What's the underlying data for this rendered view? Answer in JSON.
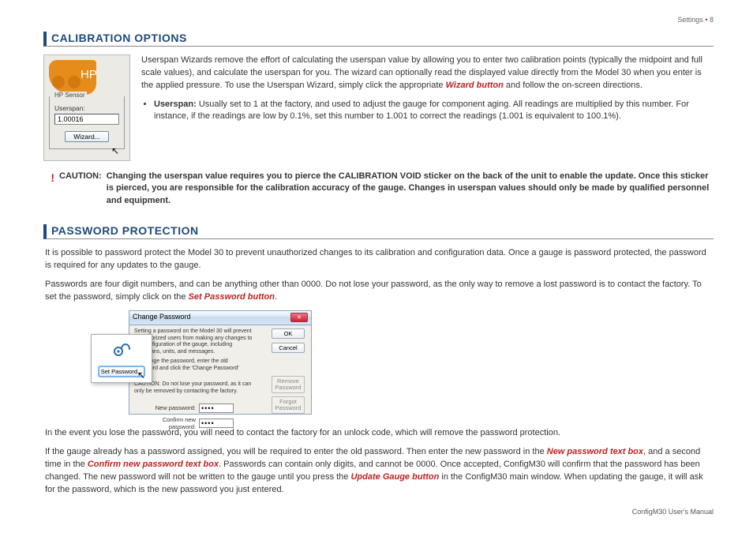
{
  "header": {
    "section": "Settings",
    "bullet": "•",
    "page": "8"
  },
  "footer": {
    "text": "ConfigM30 User's Manual"
  },
  "calib": {
    "heading": "CALIBRATION OPTIONS",
    "fig": {
      "hp": "HP",
      "sensor_label": "HP Sensor",
      "userspan_label": "Userspan:",
      "userspan_value": "1.00016",
      "wizard_btn": "Wizard..."
    },
    "p1a": "Userspan Wizards remove the effort of calculating the userspan value by allowing you to enter two calibration points (typically the midpoint and full scale values), and calculate the userspan for you. The wizard can optionally read the displayed value directly from the Model 30 when you enter is the applied pressure. To use the Userspan Wizard, simply click the appropriate ",
    "p1_wizard": "Wizard button",
    "p1b": "  and follow the on-screen directions.",
    "bullet_label": "Userspan:",
    "bullet_text": " Usually set to 1 at the factory, and used to adjust the gauge for component aging. All readings are multiplied by this number. For instance, if the readings are low by 0.1%, set this number to 1.001 to correct the readings (1.001 is equivalent to 100.1%).",
    "caution_label": "CAUTION:",
    "caution_text": "Changing the userspan value requires you to pierce the CALIBRATION VOID sticker on the back of the unit to enable the update. Once this sticker is pierced, you are responsible for the calibration accuracy of the gauge. Changes in userspan values should only be made by qualified personnel and equipment."
  },
  "pw": {
    "heading": "PASSWORD PROTECTION",
    "p1": "It is possible to password protect the Model 30 to prevent unauthorized changes to its calibration and configuration data. Once a gauge is password protected, the password is required for any updates to the gauge.",
    "p2a": "Passwords are four digit numbers, and can be anything other than 0000. Do not lose your password, as the only way to remove a lost password is to contact the factory. To set the password, simply click on the ",
    "p2_setpw": "Set Password button",
    "p2b": ".",
    "dialog": {
      "title": "Change Password",
      "desc1": "Setting a password on the Model 30 will prevent unauthorized users from making any changes to the configuration of the gauge, including userspans, units, and messages.",
      "desc2": "To change the password, enter the old password and click the 'Change Password' button.",
      "desc3": "CAUTION: Do not lose your password, as it can only be removed by contacting the factory.",
      "ok": "OK",
      "cancel": "Cancel",
      "remove": "Remove Password",
      "forgot": "Forgot Password",
      "new_label": "New password:",
      "confirm_label": "Confirm new password:",
      "new_value": "••••",
      "confirm_value": "••••"
    },
    "setpw_btn": "Set Password...",
    "p3": "In the event you lose the password, you will need to contact the factory for an unlock code, which will remove the password protection.",
    "p4a": "If the gauge already has a password assigned, you will be required to enter the old password. Then enter the new password in the ",
    "p4_new": "New password text box",
    "p4b": ", and a second time in the ",
    "p4_confirm": "Confirm new password text box",
    "p4c": ". Passwords can contain only digits, and cannot be 0000. Once accepted, ConfigM30 will confirm that the password has been changed. The new password will not be written to the gauge until you press the ",
    "p4_update": "Update Gauge button",
    "p4d": " in the ConfigM30 main window. When updating the gauge, it will ask for the password, which is the new password you just entered."
  }
}
